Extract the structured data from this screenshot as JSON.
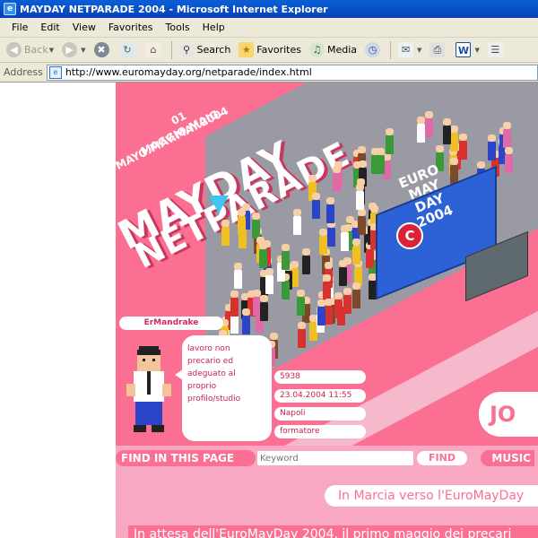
{
  "window": {
    "title": "MAYDAY NETPARADE 2004 - Microsoft Internet Explorer"
  },
  "menu": [
    "File",
    "Edit",
    "View",
    "Favorites",
    "Tools",
    "Help"
  ],
  "toolbar": {
    "back": "Back",
    "search": "Search",
    "favorites": "Favorites",
    "media": "Media"
  },
  "address": {
    "label": "Address",
    "url": "http://www.euromayday.org/netparade/index.html"
  },
  "banner": {
    "date_line_1": "01",
    "date_line_2": "MAGGIO.MAIG.",
    "date_line_3": "MAYO.MAY.MAY.2004",
    "logo_line_1": "MAYDAY",
    "logo_line_2": "NETPARADE",
    "truck_text_1": "EURO",
    "truck_text_2": "MAY",
    "truck_text_3": "DAY",
    "truck_text_4": "2004",
    "truck_logo": "C"
  },
  "profile": {
    "name": "ErMandrake",
    "message_lines": [
      "lavoro non",
      "precario ed",
      "adeguato al",
      "proprio",
      "profilo/studio"
    ],
    "id": "5938",
    "datetime": "23.04.2004 11:55",
    "city": "Napoli",
    "role": "formatore"
  },
  "join_label": "JO",
  "find": {
    "label": "FIND IN THIS PAGE",
    "placeholder": "Keyword",
    "button": "FIND",
    "music": "MUSIC"
  },
  "article": {
    "headline": "In Marcia verso l'EuroMayDay",
    "intro": "In attesa dell'EuroMayDay 2004, il primo maggio dei precari"
  },
  "colors": {
    "brand_pink": "#fb6f93",
    "light_pink": "#f8a9c1",
    "street_gray": "#9a9aa4",
    "truck_blue": "#2d62d6",
    "marker_cyan": "#3fc6f0"
  }
}
